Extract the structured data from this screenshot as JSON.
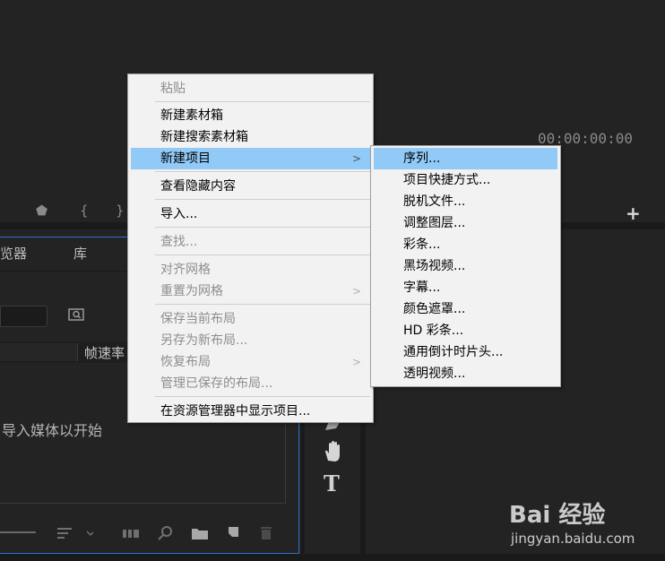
{
  "program_monitor": {
    "timecode": "00:00:00:00",
    "add_icon": "+"
  },
  "source_controls": {
    "marker_icon": "⬟",
    "in_icon": "{",
    "out_icon": "}"
  },
  "project_panel": {
    "tabs": [
      "览器",
      "库"
    ],
    "column_header": "帧速率",
    "empty_message": "导入媒体以开始"
  },
  "tools": {
    "type_tool": "T"
  },
  "context_menu": {
    "items": [
      {
        "label": "粘贴",
        "enabled": false
      },
      {
        "label": "新建素材箱",
        "enabled": true
      },
      {
        "label": "新建搜索素材箱",
        "enabled": true
      },
      {
        "label": "新建项目",
        "enabled": true,
        "submenu": true,
        "highlighted": true
      },
      {
        "label": "查看隐藏内容",
        "enabled": true
      },
      {
        "label": "导入...",
        "enabled": true
      },
      {
        "label": "查找...",
        "enabled": false
      },
      {
        "label": "对齐网格",
        "enabled": false
      },
      {
        "label": "重置为网格",
        "enabled": false,
        "submenu": true
      },
      {
        "label": "保存当前布局",
        "enabled": false
      },
      {
        "label": "另存为新布局...",
        "enabled": false
      },
      {
        "label": "恢复布局",
        "enabled": false,
        "submenu": true
      },
      {
        "label": "管理已保存的布局...",
        "enabled": false
      },
      {
        "label": "在资源管理器中显示项目...",
        "enabled": true
      }
    ],
    "submenu_arrow": ">"
  },
  "new_item_submenu": {
    "items": [
      "序列...",
      "项目快捷方式...",
      "脱机文件...",
      "调整图层...",
      "彩条...",
      "黑场视频...",
      "字幕...",
      "颜色遮罩...",
      "HD 彩条...",
      "通用倒计时片头...",
      "透明视频..."
    ]
  },
  "watermark": {
    "logo": "Bai 经验",
    "url": "jingyan.baidu.com"
  },
  "colors": {
    "highlight": "#91c9f7",
    "panel_focus_border": "#2d6fd0",
    "background": "#232323"
  }
}
